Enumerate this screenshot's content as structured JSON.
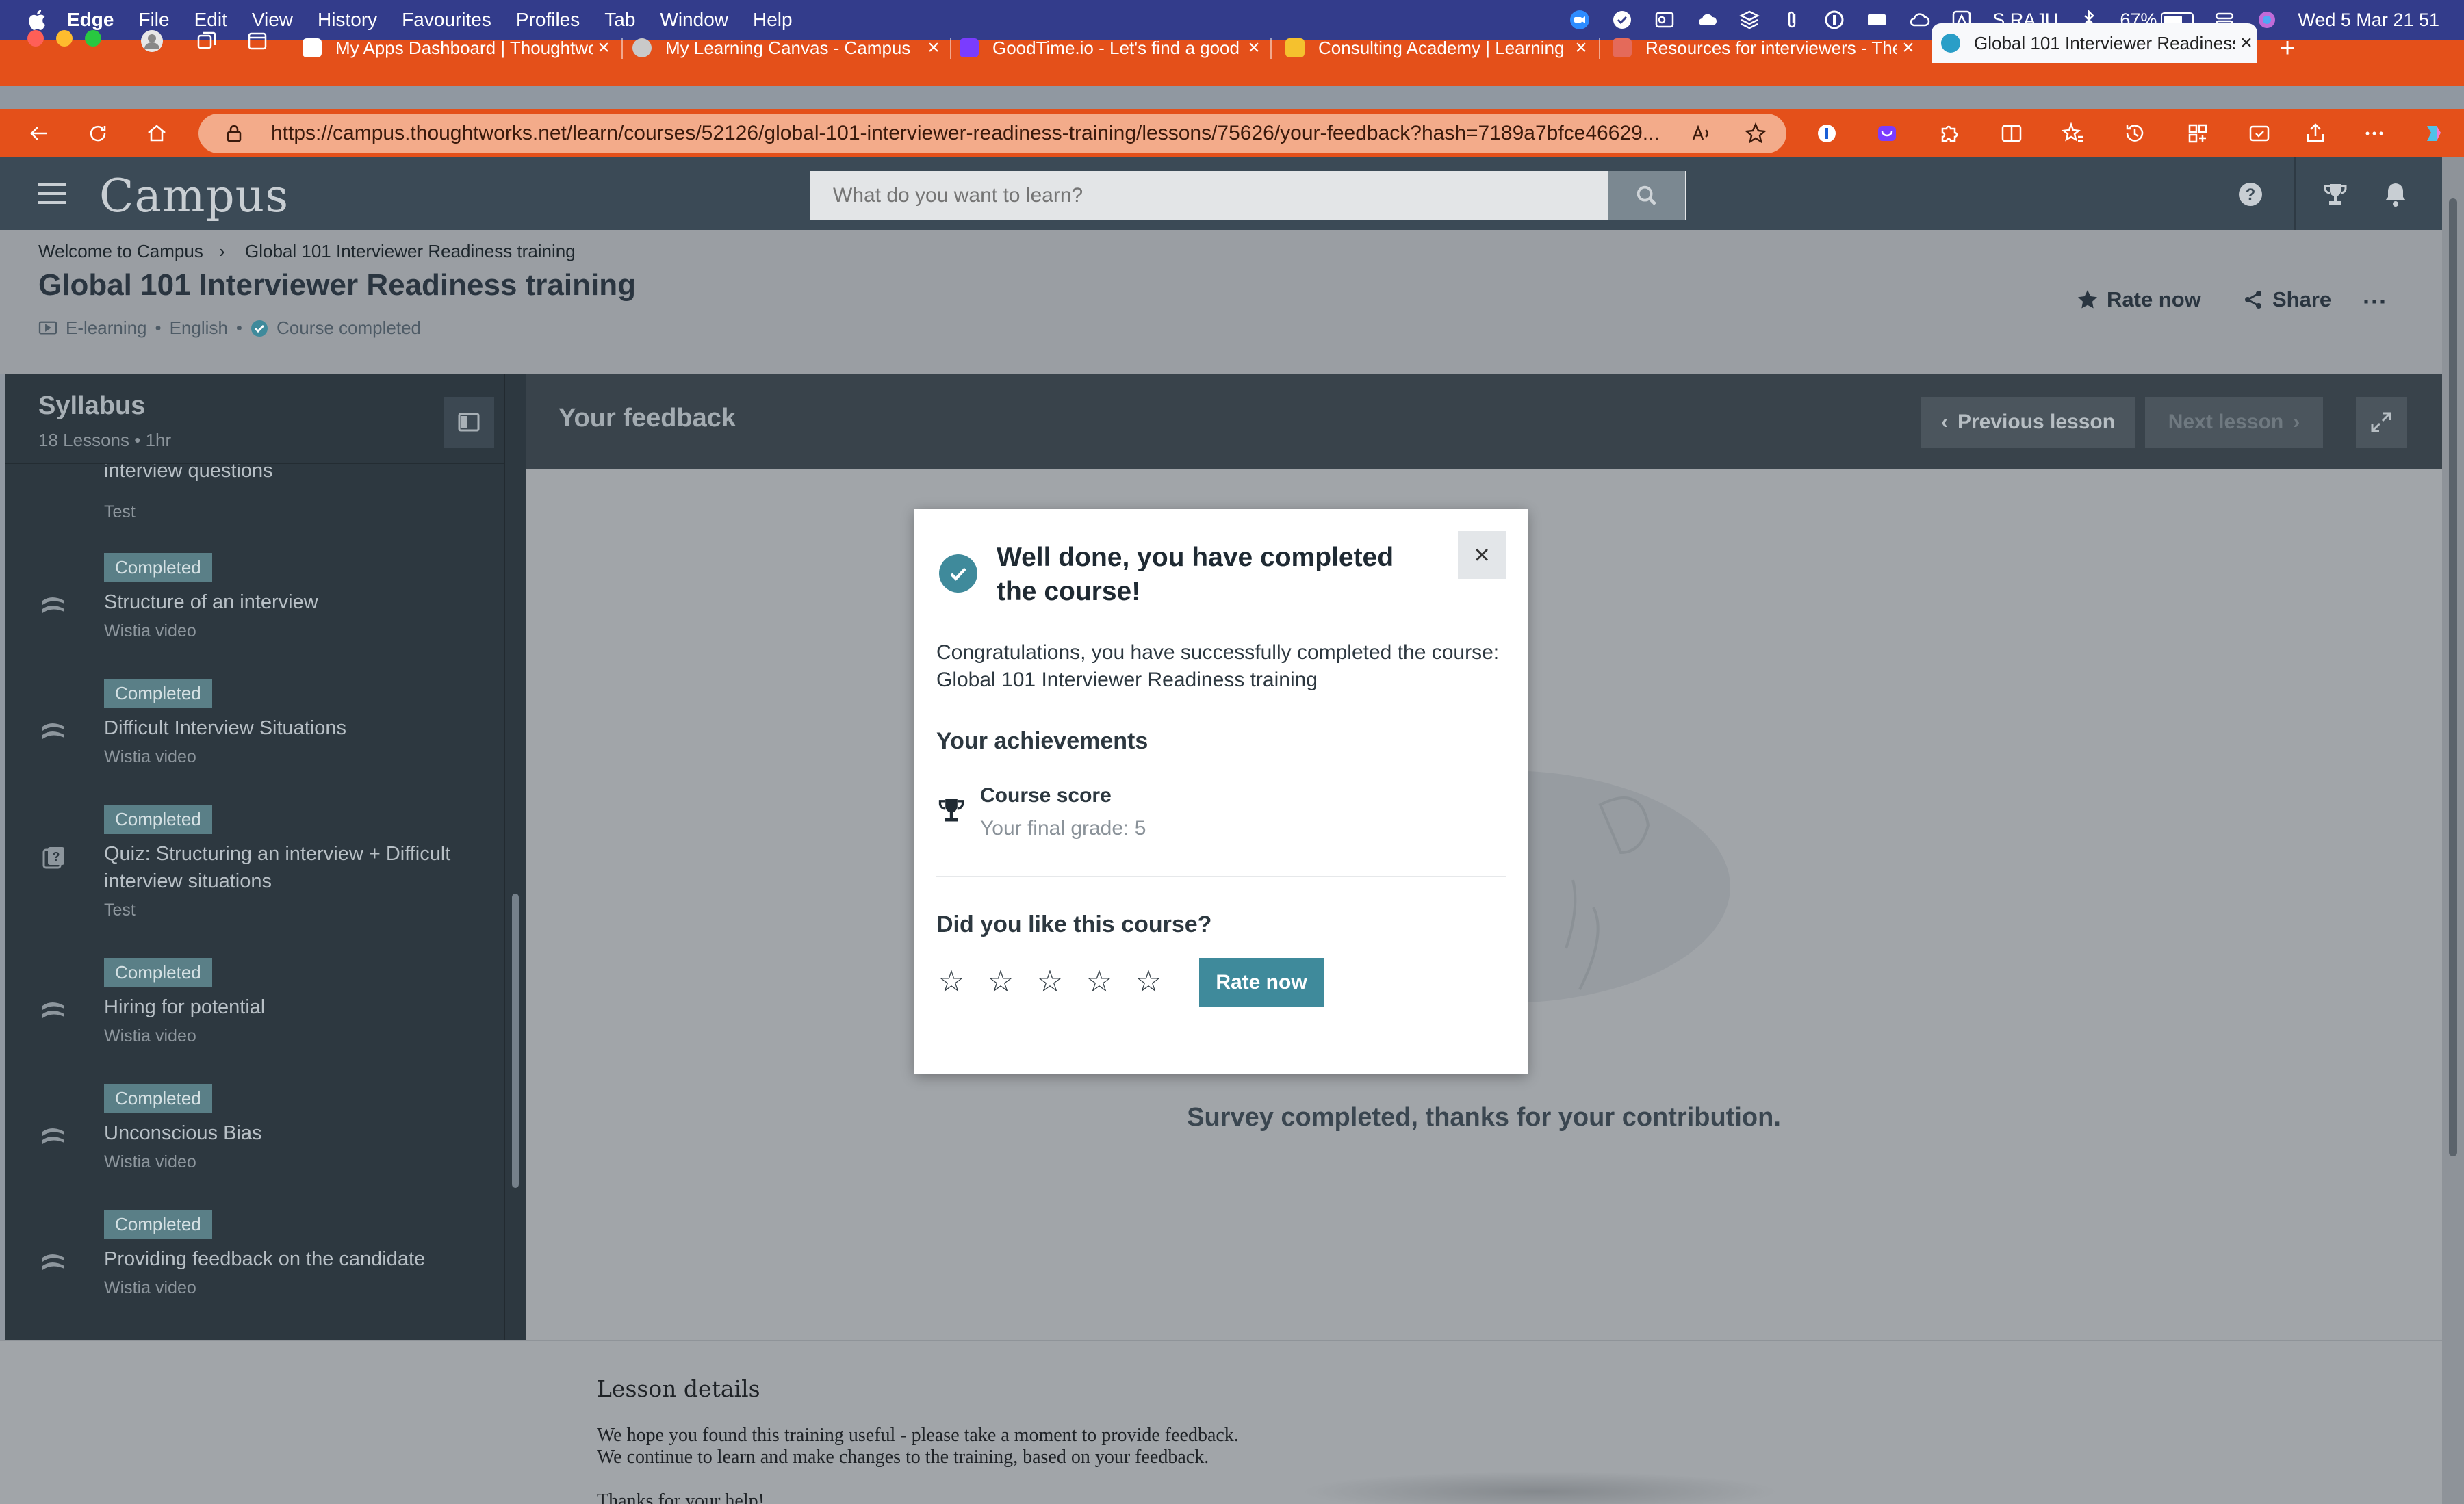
{
  "menubar": {
    "app_name": "Edge",
    "items": [
      "File",
      "Edit",
      "View",
      "History",
      "Favourites",
      "Profiles",
      "Tab",
      "Window",
      "Help"
    ],
    "user": "S RAJU",
    "battery": "67%",
    "datetime": "Wed 5 Mar  21 51"
  },
  "tabs": [
    {
      "title": "My Apps Dashboard | Thoughtworks",
      "favicon_color": "#ffffff"
    },
    {
      "title": "My Learning Canvas - Campus",
      "favicon_color": "#c9c9c9"
    },
    {
      "title": "GoodTime.io - Let's find a good time",
      "favicon_color": "#7a3cff"
    },
    {
      "title": "Consulting Academy | Learning",
      "favicon_color": "#f5c12e"
    },
    {
      "title": "Resources for interviewers - The",
      "favicon_color": "#e46a5a"
    },
    {
      "title": "Global 101 Interviewer Readiness",
      "favicon_color": "#2a9ec7",
      "active": true
    }
  ],
  "tab_close": "×",
  "new_tab": "+",
  "address": {
    "url": "https://campus.thoughtworks.net/learn/courses/52126/global-101-interviewer-readiness-training/lessons/75626/your-feedback?hash=7189a7bfce46629..."
  },
  "app": {
    "logo": "Campus",
    "search_placeholder": "What do you want to learn?"
  },
  "breadcrumb": {
    "home": "Welcome to Campus",
    "separator": "›",
    "current": "Global 101 Interviewer Readiness training"
  },
  "course": {
    "title": "Global 101 Interviewer Readiness training",
    "format": "E-learning",
    "language": "English",
    "bullet": "•",
    "status": "Course completed",
    "rate_label": "Rate now",
    "share_label": "Share",
    "more_label": "···"
  },
  "syllabus": {
    "title": "Syllabus",
    "lessons_count": "18 Lessons",
    "duration": "1hr",
    "lessons": [
      {
        "badge": "",
        "title": "interview questions",
        "type": "Test",
        "icon": "quiz-icon"
      },
      {
        "badge": "Completed",
        "title": "Structure of an interview",
        "type": "Wistia video",
        "icon": "video-icon"
      },
      {
        "badge": "Completed",
        "title": "Difficult Interview Situations",
        "type": "Wistia video",
        "icon": "video-icon"
      },
      {
        "badge": "Completed",
        "title": "Quiz: Structuring an interview + Difficult interview situations",
        "type": "Test",
        "icon": "quiz-icon"
      },
      {
        "badge": "Completed",
        "title": "Hiring for potential",
        "type": "Wistia video",
        "icon": "video-icon"
      },
      {
        "badge": "Completed",
        "title": "Unconscious Bias",
        "type": "Wistia video",
        "icon": "video-icon"
      },
      {
        "badge": "Completed",
        "title": "Providing feedback on the candidate",
        "type": "Wistia video",
        "icon": "video-icon"
      }
    ]
  },
  "lesson": {
    "title": "Your feedback",
    "prev_label": "Previous lesson",
    "next_label": "Next lesson",
    "survey_done": "Survey completed, thanks for your contribution."
  },
  "details": {
    "heading": "Lesson details",
    "line1": "We hope you found this training useful - please take a moment to provide feedback.",
    "line2": "We continue to learn and make changes to the training, based on your feedback.",
    "line3": "Thanks for your help!"
  },
  "modal": {
    "title": "Well done, you have completed the course!",
    "close": "×",
    "body_line1": "Congratulations, you have successfully completed the course:",
    "body_line2": "Global 101 Interviewer Readiness training",
    "achievements_heading": "Your achievements",
    "score_label": "Course score",
    "score_value": "Your final grade: 5",
    "like_question": "Did you like this course?",
    "rating": 0,
    "star_glyph": "☆",
    "rate_button": "Rate now"
  },
  "colors": {
    "accent": "#3f8a9b",
    "browser_chrome": "#e4501a",
    "app_header": "#3b4a56",
    "sidebar": "#2d3840"
  }
}
